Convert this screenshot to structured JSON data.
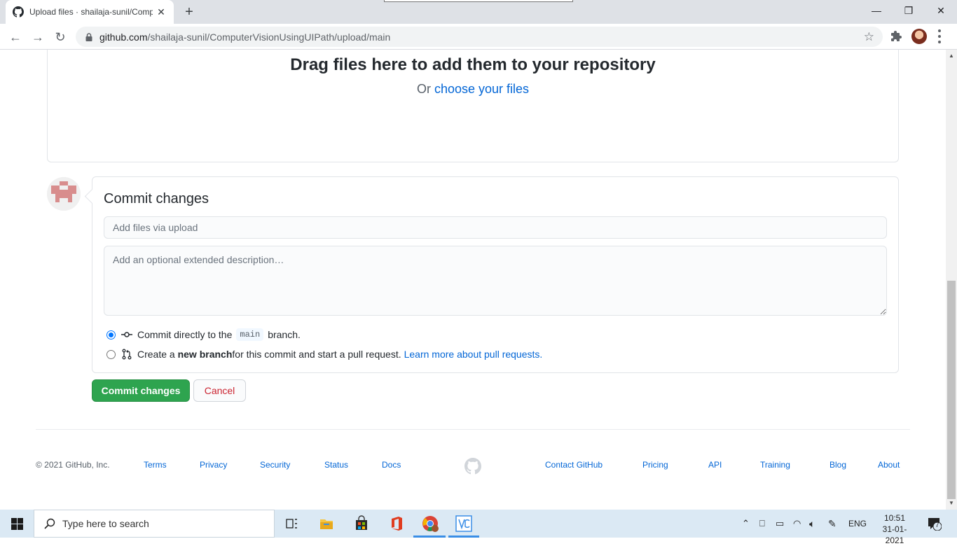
{
  "browser": {
    "tab_title": "Upload files · shailaja-sunil/Comp",
    "url_host": "github.com",
    "url_path": "/shailaja-sunil/ComputerVisionUsingUIPath/upload/main"
  },
  "upload": {
    "title": "Drag files here to add them to your repository",
    "or_text": "Or ",
    "choose_link": "choose your files"
  },
  "commit": {
    "title": "Commit changes",
    "summary_placeholder": "Add files via upload",
    "description_placeholder": "Add an optional extended description…",
    "option_direct_prefix": "Commit directly to the",
    "branch_name": "main",
    "option_direct_suffix": "branch.",
    "option_new_prefix": "Create a ",
    "option_new_bold": "new branch",
    "option_new_suffix": " for this commit and start a pull request.",
    "learn_more": "Learn more about pull requests.",
    "selected_option": "direct",
    "submit_label": "Commit changes",
    "cancel_label": "Cancel"
  },
  "footer": {
    "copyright": "© 2021 GitHub, Inc.",
    "left_links": [
      "Terms",
      "Privacy",
      "Security",
      "Status",
      "Docs"
    ],
    "right_links": [
      "Contact GitHub",
      "Pricing",
      "API",
      "Training",
      "Blog",
      "About"
    ]
  },
  "taskbar": {
    "search_placeholder": "Type here to search",
    "language": "ENG",
    "time": "10:51",
    "date": "31-01-2021",
    "notification_count": "7"
  },
  "colors": {
    "primary_button": "#2ea44f",
    "link": "#0366d6",
    "cancel_text": "#cb2431"
  }
}
